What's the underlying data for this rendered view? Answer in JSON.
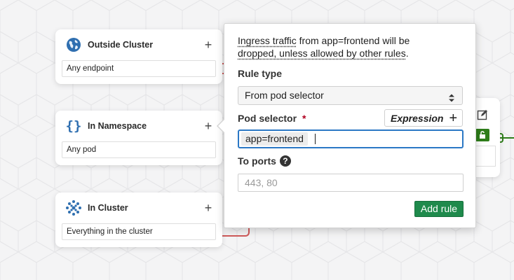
{
  "cards": {
    "outside_cluster": {
      "title": "Outside Cluster",
      "field": "Any endpoint",
      "add": "+"
    },
    "in_namespace": {
      "title": "In Namespace",
      "field": "Any pod",
      "add": "+"
    },
    "in_cluster": {
      "title": "In Cluster",
      "field": "Everything in the cluster",
      "add": "+"
    }
  },
  "popover": {
    "info_text_1": "Ingress traffic",
    "info_text_2": " from app=frontend will be",
    "info_text_3": "dropped, unless allowed by other rules",
    "info_text_4": ".",
    "rule_type_label": "Rule type",
    "rule_type_value": "From pod selector",
    "pod_selector_label": "Pod selector",
    "required_mark": "*",
    "expression_button": "Expression",
    "expression_plus": "+",
    "selector_chip": "app=frontend",
    "to_ports_label": "To ports",
    "help_icon": "?",
    "ports_placeholder": "443, 80",
    "add_rule_button": "Add rule"
  },
  "colors": {
    "accent_blue": "#2b78c5",
    "add_green": "#1f8a4c",
    "link_red": "#d05a5a",
    "lock_green": "#2e7d1a"
  },
  "icons": {
    "outside_cluster": "globe-icon",
    "in_namespace": "braces-icon",
    "in_cluster": "cluster-icon",
    "select": "select-arrows-icon",
    "edit": "edit-icon",
    "lock": "unlock-icon"
  }
}
